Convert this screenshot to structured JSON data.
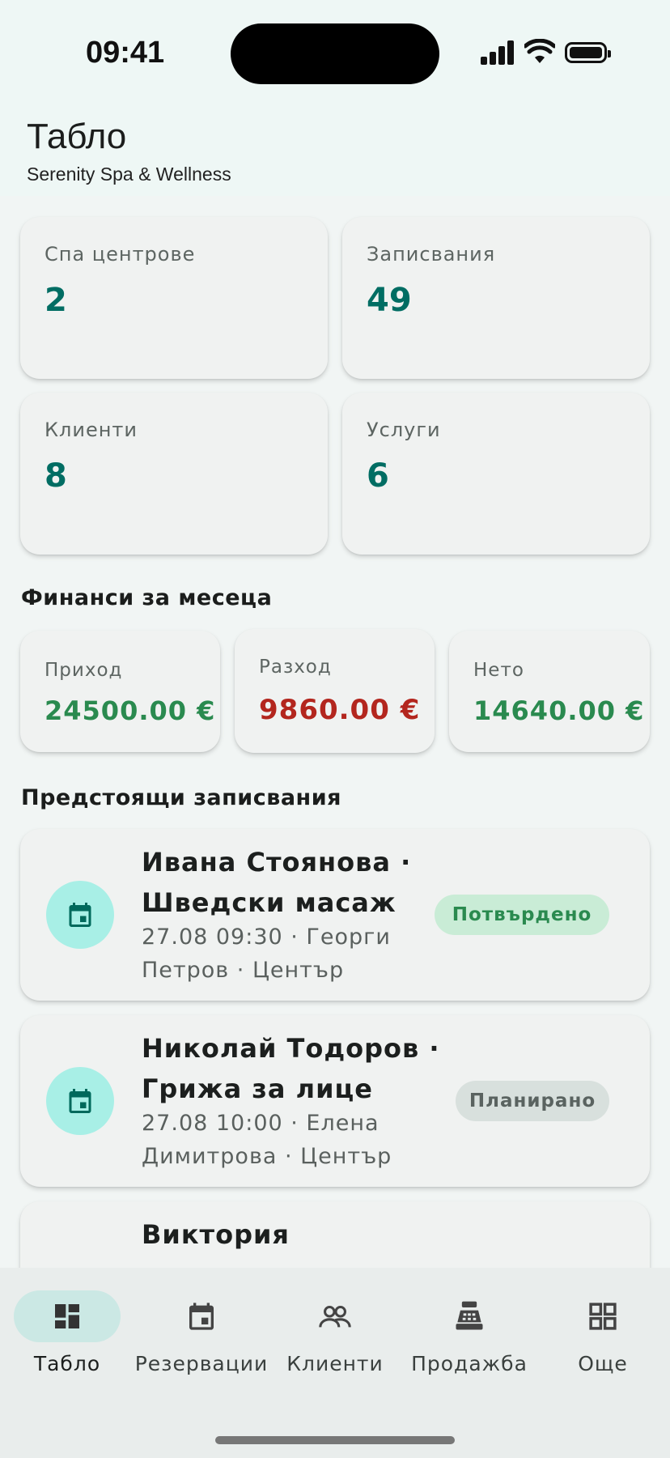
{
  "status_bar": {
    "time": "09:41"
  },
  "header": {
    "title": "Табло",
    "subtitle": "Serenity Spa & Wellness"
  },
  "stats": [
    {
      "label": "Спа центрове",
      "value": "2"
    },
    {
      "label": "Записвания",
      "value": "49"
    },
    {
      "label": "Клиенти",
      "value": "8"
    },
    {
      "label": "Услуги",
      "value": "6"
    }
  ],
  "finance": {
    "title": "Финанси за месеца",
    "items": [
      {
        "label": "Приход",
        "value": "24500.00 €",
        "color": "#2a8a4f"
      },
      {
        "label": "Разход",
        "value": "9860.00 €",
        "color": "#b3261e"
      },
      {
        "label": "Нето",
        "value": "14640.00 €",
        "color": "#2a8a4f"
      }
    ]
  },
  "upcoming": {
    "title": "Предстоящи записвания",
    "items": [
      {
        "title_line1": "Ивана Стоянова ·",
        "title_line2": "Шведски масаж",
        "sub_line1": "27.08 09:30 · Георги",
        "sub_line2": "Петров · Център",
        "status": "Потвърдено",
        "icon": "calendar-icon"
      },
      {
        "title_line1": "Николай Тодоров ·",
        "title_line2": "Грижа за лице",
        "sub_line1": "27.08 10:00 · Елена",
        "sub_line2": "Димитрова · Център",
        "status": "Планирано",
        "icon": "calendar-icon"
      },
      {
        "title_line1": "Виктория"
      }
    ]
  },
  "nav": {
    "items": [
      {
        "label": "Табло",
        "icon": "dashboard-icon",
        "active": true
      },
      {
        "label": "Резервации",
        "icon": "calendar-icon",
        "active": false
      },
      {
        "label": "Клиенти",
        "icon": "people-icon",
        "active": false
      },
      {
        "label": "Продажба",
        "icon": "cash-register-icon",
        "active": false
      },
      {
        "label": "Още",
        "icon": "grid-icon",
        "active": false
      }
    ]
  },
  "colors": {
    "accent": "#006d63",
    "income": "#2a8a4f",
    "expense": "#b3261e",
    "nav_active_bg": "#cbe8e4",
    "confirmed_bg": "#c9ecd6",
    "planned_bg": "#d8e0dd"
  }
}
